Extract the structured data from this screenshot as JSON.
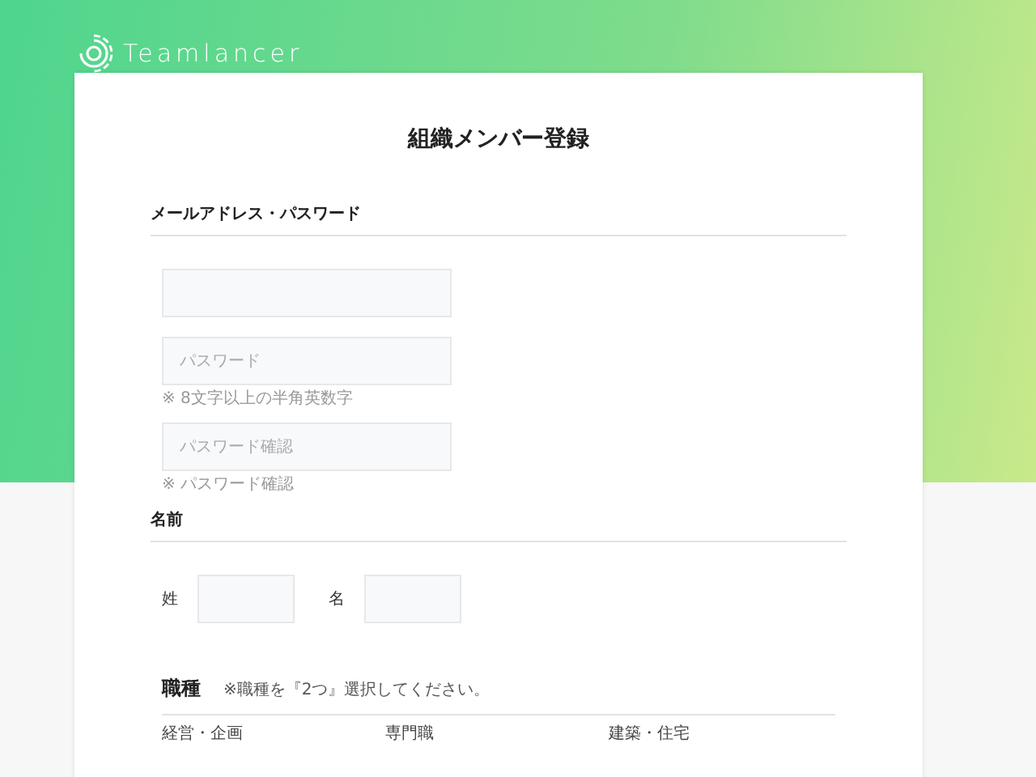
{
  "header": {
    "logo_text": "Teamlancer"
  },
  "form": {
    "title": "組織メンバー登録",
    "sections": [
      {
        "kind": "fields",
        "heading": "メールアドレス・パスワード",
        "fields": [
          {
            "disabled": false
          },
          {
            "placeholder": "パスワード",
            "hint": "※ 8文字以上の半角英数字",
            "disabled": false
          },
          {
            "placeholder": "パスワード確認",
            "hint": "※ パスワード確認",
            "disabled": false
          }
        ]
      },
      {
        "kind": "name",
        "heading": "名前",
        "fields": [
          {
            "label": "姓"
          },
          {
            "label": "名"
          }
        ]
      },
      {
        "kind": "jobs",
        "heading": "職種",
        "note": "※職種を『2つ』選択してください。",
        "options": [
          "経営・企画",
          "専門職",
          "建築・住宅"
        ]
      }
    ]
  }
}
